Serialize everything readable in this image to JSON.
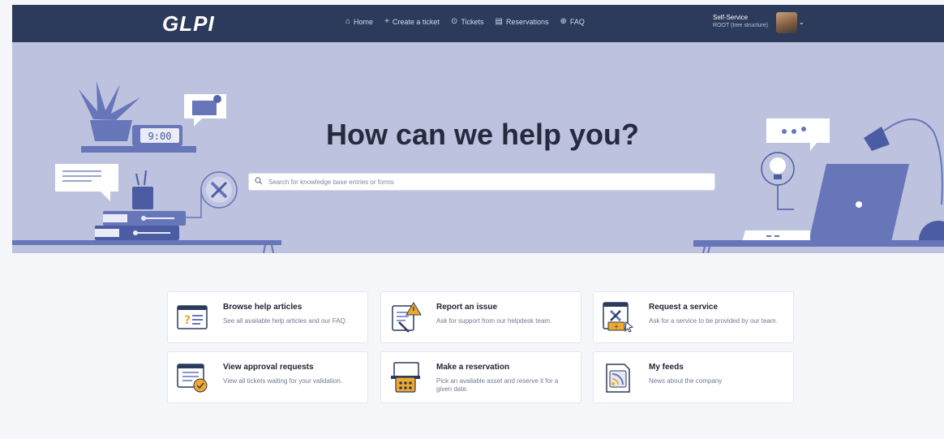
{
  "navbar": {
    "logo": "GLPI",
    "items": [
      {
        "label": "Home",
        "icon": "⌂"
      },
      {
        "label": "Create a ticket",
        "icon": "+"
      },
      {
        "label": "Tickets",
        "icon": "⊙"
      },
      {
        "label": "Reservations",
        "icon": "▤"
      },
      {
        "label": "FAQ",
        "icon": "⊕"
      }
    ],
    "user": {
      "profile": "Self-Service",
      "entity": "ROOT (tree structure)"
    },
    "colors": {
      "background": "#2c3a5c"
    }
  },
  "hero": {
    "title": "How can we help you?",
    "search": {
      "placeholder": "Search for knowledge base entries or forms",
      "value": ""
    },
    "clock_display": "9:00",
    "colors": {
      "background": "#bdc2de",
      "illustration": "#6676b8"
    }
  },
  "tiles": [
    {
      "title": "Browse help articles",
      "description": "See all available help articles and our FAQ.",
      "icon": "help-articles-icon"
    },
    {
      "title": "Report an issue",
      "description": "Ask for support from our helpdesk team.",
      "icon": "report-issue-icon"
    },
    {
      "title": "Request a service",
      "description": "Ask for a service to be provided by our team.",
      "icon": "request-service-icon"
    },
    {
      "title": "View approval requests",
      "description": "View all tickets waiting for your validation.",
      "icon": "approval-icon"
    },
    {
      "title": "Make a reservation",
      "description": "Pick an available asset and reserve it for a given date.",
      "icon": "reservation-icon"
    },
    {
      "title": "My feeds",
      "description": "News about the company",
      "icon": "feeds-icon"
    }
  ]
}
